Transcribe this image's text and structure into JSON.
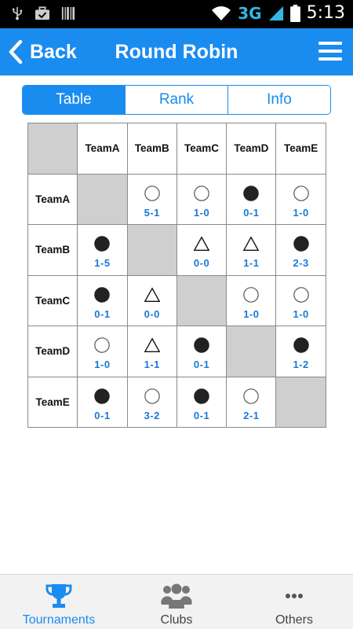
{
  "status_bar": {
    "network": "3G",
    "time": "5:13"
  },
  "header": {
    "back_label": "Back",
    "title": "Round Robin"
  },
  "tabs": [
    {
      "label": "Table",
      "active": true
    },
    {
      "label": "Rank",
      "active": false
    },
    {
      "label": "Info",
      "active": false
    }
  ],
  "table": {
    "teams": [
      "TeamA",
      "TeamB",
      "TeamC",
      "TeamD",
      "TeamE"
    ],
    "rows": [
      {
        "team": "TeamA",
        "results": [
          null,
          {
            "mark": "win",
            "score": "5-1"
          },
          {
            "mark": "win",
            "score": "1-0"
          },
          {
            "mark": "loss",
            "score": "0-1"
          },
          {
            "mark": "win",
            "score": "1-0"
          }
        ]
      },
      {
        "team": "TeamB",
        "results": [
          {
            "mark": "loss",
            "score": "1-5"
          },
          null,
          {
            "mark": "draw",
            "score": "0-0"
          },
          {
            "mark": "draw",
            "score": "1-1"
          },
          {
            "mark": "loss",
            "score": "2-3"
          }
        ]
      },
      {
        "team": "TeamC",
        "results": [
          {
            "mark": "loss",
            "score": "0-1"
          },
          {
            "mark": "draw",
            "score": "0-0"
          },
          null,
          {
            "mark": "win",
            "score": "1-0"
          },
          {
            "mark": "win",
            "score": "1-0"
          }
        ]
      },
      {
        "team": "TeamD",
        "results": [
          {
            "mark": "win",
            "score": "1-0"
          },
          {
            "mark": "draw",
            "score": "1-1"
          },
          {
            "mark": "loss",
            "score": "0-1"
          },
          null,
          {
            "mark": "loss",
            "score": "1-2"
          }
        ]
      },
      {
        "team": "TeamE",
        "results": [
          {
            "mark": "loss",
            "score": "0-1"
          },
          {
            "mark": "win",
            "score": "3-2"
          },
          {
            "mark": "loss",
            "score": "0-1"
          },
          {
            "mark": "win",
            "score": "2-1"
          },
          null
        ]
      }
    ]
  },
  "bottom_nav": [
    {
      "label": "Tournaments",
      "icon": "trophy-icon",
      "active": true
    },
    {
      "label": "Clubs",
      "icon": "group-icon",
      "active": false
    },
    {
      "label": "Others",
      "icon": "more-dots-icon",
      "active": false
    }
  ],
  "colors": {
    "accent": "#1a8cf0",
    "score": "#1a78d8",
    "diagonal": "#cfcfcf"
  }
}
